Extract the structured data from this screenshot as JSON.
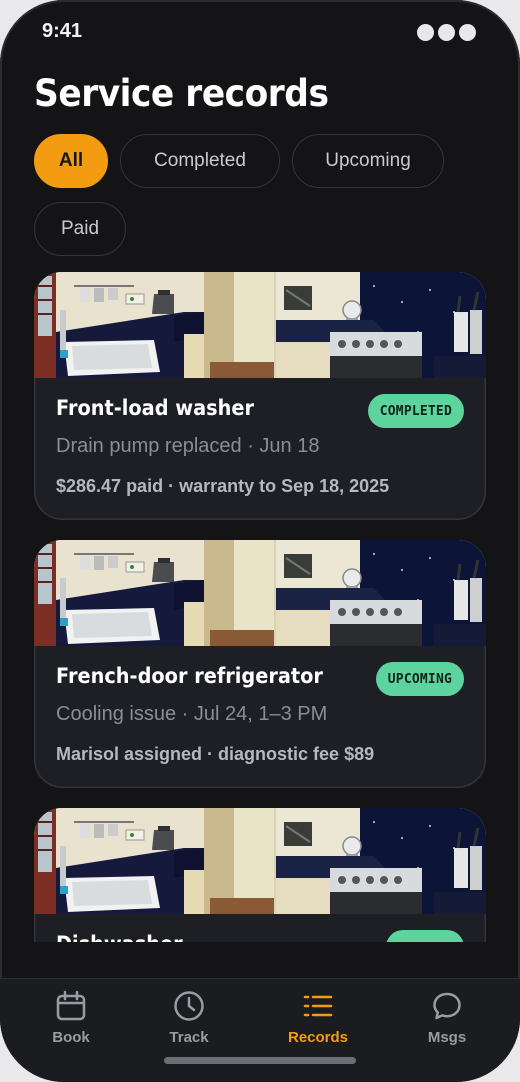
{
  "status_bar": {
    "time": "9:41"
  },
  "header": {
    "title": "Service records"
  },
  "filters": [
    {
      "label": "All",
      "active": true
    },
    {
      "label": "Completed",
      "active": false
    },
    {
      "label": "Upcoming",
      "active": false
    },
    {
      "label": "Paid",
      "active": false
    }
  ],
  "records": [
    {
      "title": "Front-load washer",
      "status": "COMPLETED",
      "subtitle": "Drain pump replaced · Jun 18",
      "meta": "$286.47 paid · warranty to Sep 18, 2025"
    },
    {
      "title": "French-door refrigerator",
      "status": "UPCOMING",
      "subtitle": "Cooling issue · Jul 24, 1–3 PM",
      "meta": "Marisol assigned · diagnostic fee $89"
    },
    {
      "title": "Dishwasher",
      "status": "",
      "subtitle": "",
      "meta": ""
    }
  ],
  "tab_bar": {
    "tabs": [
      {
        "label": "Book",
        "icon": "calendar-icon"
      },
      {
        "label": "Track",
        "icon": "clock-icon"
      },
      {
        "label": "Records",
        "icon": "list-icon",
        "active": true
      },
      {
        "label": "Msgs",
        "icon": "chat-bubble-icon"
      }
    ]
  },
  "colors": {
    "accent": "#f39c12",
    "badge": "#5dd39e",
    "background": "#141416",
    "card": "#1e1f24"
  }
}
